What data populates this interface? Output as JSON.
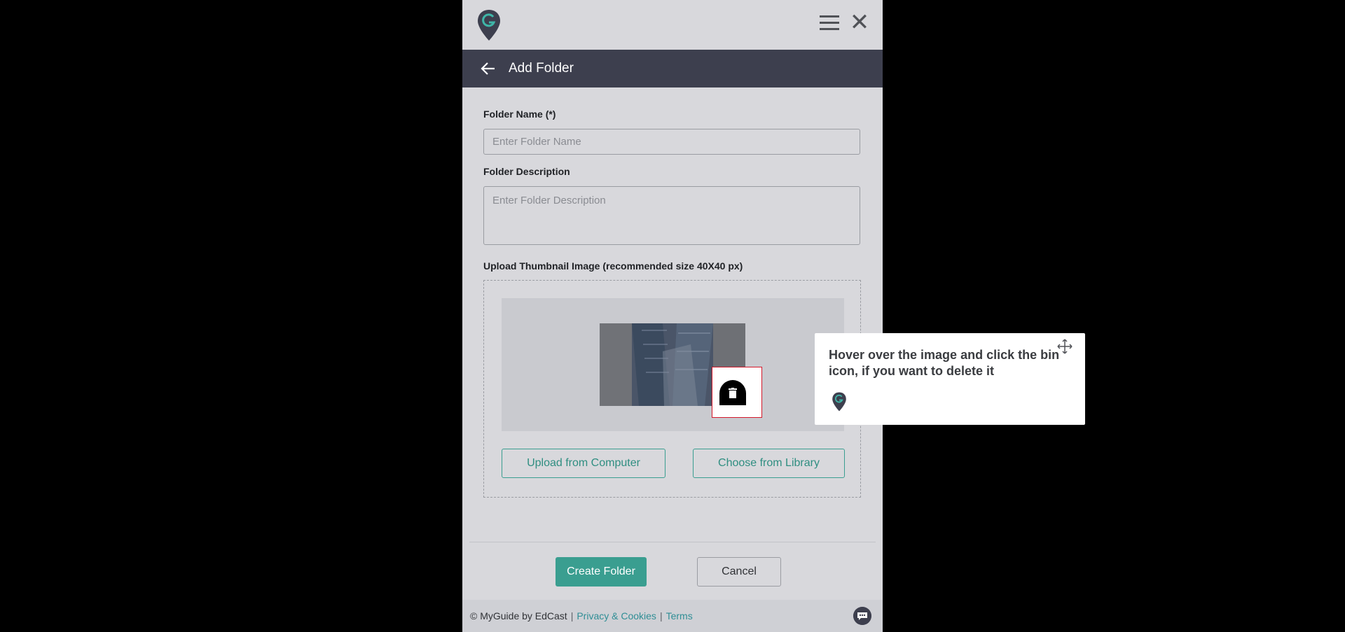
{
  "header": {
    "title": "Add Folder"
  },
  "form": {
    "folder_name_label": "Folder Name (*)",
    "folder_name_placeholder": "Enter Folder Name",
    "folder_name_value": "",
    "description_label": "Folder Description",
    "description_placeholder": "Enter Folder Description",
    "thumbnail_label": "Upload Thumbnail Image (recommended size 40X40 px)",
    "upload_button": "Upload from Computer",
    "library_button": "Choose from Library"
  },
  "actions": {
    "create": "Create Folder",
    "cancel": "Cancel"
  },
  "footer": {
    "copyright": "© MyGuide by EdCast",
    "privacy": "Privacy & Cookies",
    "terms": "Terms"
  },
  "tooltip": {
    "text": "Hover over the image and click the bin icon, if you want to delete it"
  },
  "icons": {
    "logo": "myguide-logo-icon",
    "menu": "hamburger-icon",
    "close": "close-icon",
    "back": "back-arrow-icon",
    "bin": "trash-icon",
    "move": "move-icon",
    "chat": "chat-icon"
  },
  "colors": {
    "accent": "#3a9e90",
    "header": "#3d3f4e",
    "highlight": "#d4182a"
  }
}
